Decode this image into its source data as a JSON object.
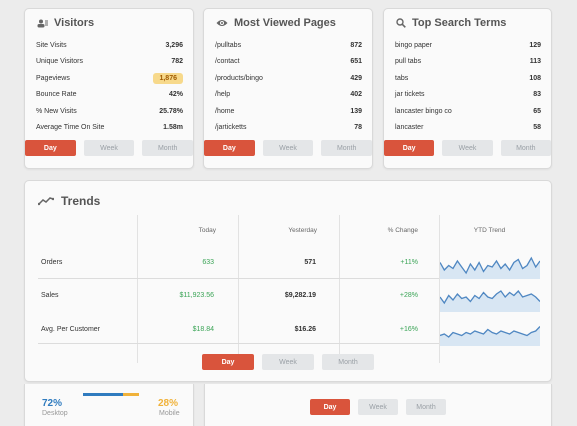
{
  "visitors": {
    "title": "Visitors",
    "rows": [
      {
        "label": "Site Visits",
        "value": "3,296"
      },
      {
        "label": "Unique Visitors",
        "value": "782"
      },
      {
        "label": "Pageviews",
        "value": "1,876"
      },
      {
        "label": "Bounce Rate",
        "value": "42%"
      },
      {
        "label": "% New Visits",
        "value": "25.78%"
      },
      {
        "label": "Average Time On Site",
        "value": "1.58m"
      }
    ]
  },
  "pages": {
    "title": "Most Viewed Pages",
    "rows": [
      {
        "label": "/pulltabs",
        "value": "872"
      },
      {
        "label": "/contact",
        "value": "651"
      },
      {
        "label": "/products/bingo",
        "value": "429"
      },
      {
        "label": "/help",
        "value": "402"
      },
      {
        "label": "/home",
        "value": "139"
      },
      {
        "label": "/jarticketts",
        "value": "78"
      }
    ]
  },
  "search": {
    "title": "Top Search Terms",
    "rows": [
      {
        "label": "bingo paper",
        "value": "129"
      },
      {
        "label": "pull tabs",
        "value": "113"
      },
      {
        "label": "tabs",
        "value": "108"
      },
      {
        "label": "jar tickets",
        "value": "83"
      },
      {
        "label": "lancaster bingo co",
        "value": "65"
      },
      {
        "label": "lancaster",
        "value": "58"
      }
    ]
  },
  "range_buttons": {
    "day": "Day",
    "week": "Week",
    "month": "Month"
  },
  "trends": {
    "title": "Trends",
    "headers": {
      "today": "Today",
      "yesterday": "Yesterday",
      "change": "% Change",
      "ytd": "YTD Trend"
    },
    "rows": [
      {
        "label": "Orders",
        "today": "633",
        "yesterday": "571",
        "change": "+11%",
        "spark": [
          0.55,
          0.3,
          0.45,
          0.35,
          0.6,
          0.4,
          0.2,
          0.5,
          0.3,
          0.55,
          0.25,
          0.45,
          0.4,
          0.6,
          0.35,
          0.5,
          0.3,
          0.55,
          0.65,
          0.35,
          0.45,
          0.7,
          0.4,
          0.6
        ]
      },
      {
        "label": "Sales",
        "today": "$11,923.56",
        "yesterday": "$9,282.19",
        "change": "+28%",
        "spark": [
          0.5,
          0.3,
          0.55,
          0.4,
          0.6,
          0.45,
          0.5,
          0.35,
          0.55,
          0.45,
          0.65,
          0.5,
          0.45,
          0.6,
          0.7,
          0.5,
          0.65,
          0.55,
          0.7,
          0.5,
          0.55,
          0.6,
          0.5,
          0.35
        ]
      },
      {
        "label": "Avg. Per Customer",
        "today": "$18.84",
        "yesterday": "$16.26",
        "change": "+16%",
        "spark": [
          0.35,
          0.4,
          0.3,
          0.45,
          0.4,
          0.35,
          0.45,
          0.4,
          0.5,
          0.45,
          0.4,
          0.55,
          0.45,
          0.4,
          0.5,
          0.45,
          0.4,
          0.5,
          0.45,
          0.4,
          0.35,
          0.45,
          0.5,
          0.65
        ]
      }
    ]
  },
  "device": {
    "desktop_pct": "72%",
    "desktop_label": "Desktop",
    "mobile_pct": "28%",
    "mobile_label": "Mobile",
    "desktop_share": 0.72,
    "desktop_color": "#2f7bbf",
    "mobile_color": "#f0b23a"
  },
  "colors": {
    "accent": "#d9543c",
    "positive": "#3aa456",
    "spark_line": "#4f87c2",
    "spark_fill": "#d8e6f3"
  }
}
